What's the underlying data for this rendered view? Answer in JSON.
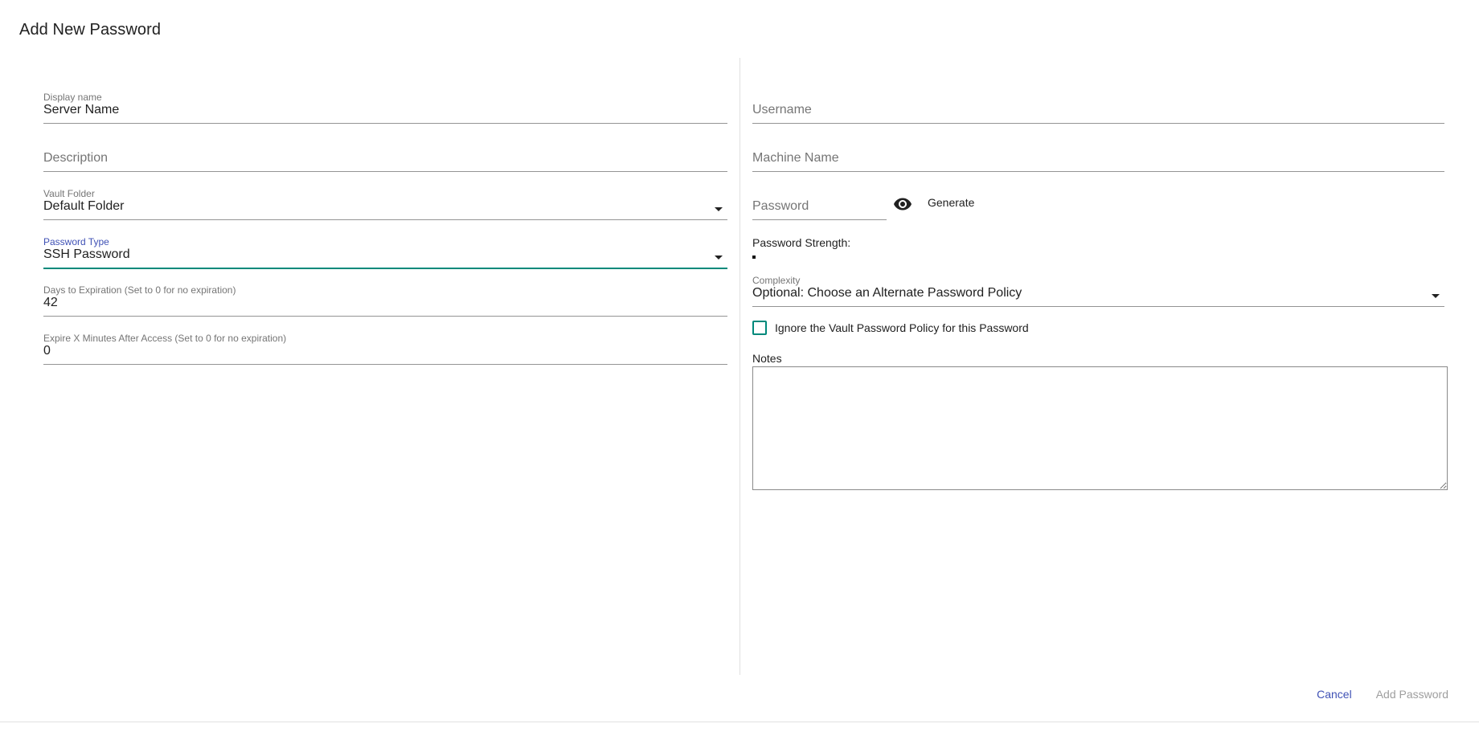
{
  "dialog": {
    "title": "Add New Password"
  },
  "left": {
    "display_name": {
      "label": "Display name",
      "value": "Server Name"
    },
    "description": {
      "placeholder": "Description"
    },
    "vault_folder": {
      "label": "Vault Folder",
      "value": "Default Folder"
    },
    "password_type": {
      "label": "Password Type",
      "value": "SSH Password"
    },
    "days_to_expiration": {
      "label": "Days to Expiration (Set to 0 for no expiration)",
      "value": "42"
    },
    "expire_minutes": {
      "label": "Expire X Minutes After Access (Set to 0 for no expiration)",
      "value": "0"
    }
  },
  "right": {
    "username": {
      "placeholder": "Username"
    },
    "machine_name": {
      "placeholder": "Machine Name"
    },
    "password": {
      "placeholder": "Password"
    },
    "generate_label": "Generate",
    "visibility_icon": "eye-icon",
    "strength_label": "Password Strength:",
    "complexity": {
      "label": "Complexity",
      "value": "Optional: Choose an Alternate Password Policy"
    },
    "ignore_policy_label": "Ignore the Vault Password Policy for this Password",
    "ignore_policy_checked": false,
    "notes_label": "Notes",
    "notes_value": ""
  },
  "actions": {
    "cancel_label": "Cancel",
    "submit_label": "Add Password"
  },
  "colors": {
    "primary": "#3f51b5",
    "accent": "#00897b",
    "disabled": "#9e9e9e"
  }
}
